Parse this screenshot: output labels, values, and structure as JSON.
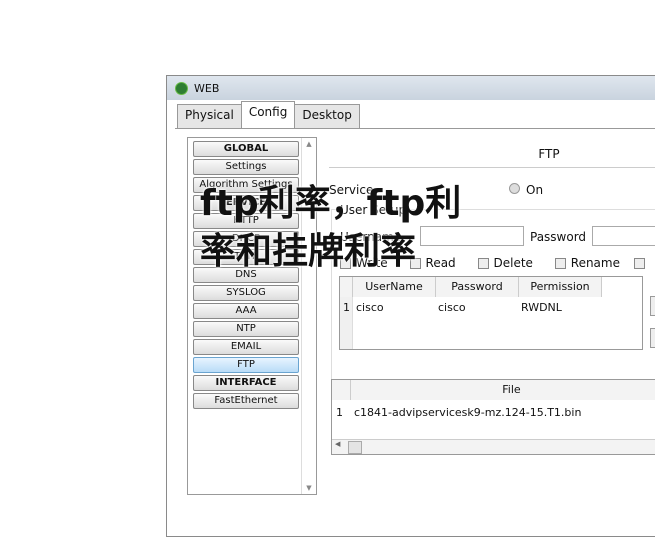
{
  "window": {
    "title": "WEB"
  },
  "tabs": [
    {
      "label": "Physical"
    },
    {
      "label": "Config"
    },
    {
      "label": "Desktop"
    }
  ],
  "sidebar": {
    "items": [
      {
        "label": "GLOBAL",
        "bold": true
      },
      {
        "label": "Settings"
      },
      {
        "label": "Algorithm Settings"
      },
      {
        "label": "SERVICES",
        "bold": true
      },
      {
        "label": "HTTP"
      },
      {
        "label": "DHCP"
      },
      {
        "label": "TFTP"
      },
      {
        "label": "DNS"
      },
      {
        "label": "SYSLOG"
      },
      {
        "label": "AAA"
      },
      {
        "label": "NTP"
      },
      {
        "label": "EMAIL"
      },
      {
        "label": "FTP",
        "selected": true
      },
      {
        "label": "INTERFACE",
        "bold": true
      },
      {
        "label": "FastEthernet"
      }
    ]
  },
  "ftp": {
    "title": "FTP",
    "service_label": "Service",
    "on_label": "On",
    "user_setup_label": "User Setup",
    "username_label": "Username",
    "password_label": "Password",
    "permissions": [
      "Write",
      "Read",
      "Delete",
      "Rename"
    ],
    "users_table": {
      "columns": [
        "UserName",
        "Password",
        "Permission"
      ],
      "rows": [
        {
          "index": "1",
          "username": "cisco",
          "password": "cisco",
          "permission": "RWDNL"
        }
      ]
    },
    "files_table": {
      "column": "File",
      "rows": [
        {
          "index": "1",
          "file": "c1841-advipservicesk9-mz.124-15.T1.bin"
        }
      ]
    }
  },
  "overlay": {
    "line1": "ftp利率，ftp利",
    "line2": "率和挂牌利率"
  }
}
